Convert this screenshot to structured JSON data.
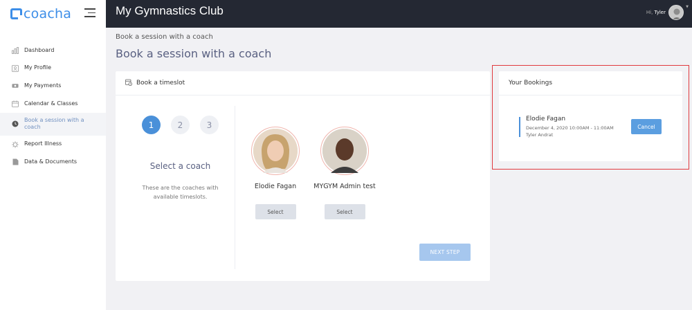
{
  "brand": {
    "name": "coacha",
    "color": "#3d8ee8"
  },
  "header": {
    "title": "My Gymnastics Club",
    "greeting_prefix": "Hi,",
    "user_name": "Tyler"
  },
  "sidebar": {
    "items": [
      {
        "label": "Dashboard",
        "icon": "chart-icon",
        "active": false
      },
      {
        "label": "My Profile",
        "icon": "profile-card-icon",
        "active": false
      },
      {
        "label": "My Payments",
        "icon": "money-icon",
        "active": false
      },
      {
        "label": "Calendar & Classes",
        "icon": "calendar-icon",
        "active": false
      },
      {
        "label": "Book a session with a coach",
        "icon": "clock-icon",
        "active": true
      },
      {
        "label": "Report Illness",
        "icon": "virus-icon",
        "active": false
      },
      {
        "label": "Data & Documents",
        "icon": "document-icon",
        "active": false
      }
    ]
  },
  "page": {
    "breadcrumb": "Book a session with a coach",
    "title": "Book a session with a coach"
  },
  "timeslot_card": {
    "title": "Book a timeslot",
    "steps": [
      "1",
      "2",
      "3"
    ],
    "active_step": 1,
    "step_title": "Select a coach",
    "step_desc": "These are the coaches with available timeslots.",
    "coaches": [
      {
        "name": "Elodie Fagan",
        "select_label": "Select"
      },
      {
        "name": "MYGYM Admin test",
        "select_label": "Select"
      }
    ],
    "next_label": "NEXT STEP"
  },
  "bookings_card": {
    "title": "Your Bookings",
    "items": [
      {
        "coach": "Elodie Fagan",
        "time": "December 4, 2020 10:00AM - 11:00AM",
        "person": "Tyler Andrat",
        "cancel_label": "Cancel"
      }
    ]
  },
  "colors": {
    "accent": "#4a90d9",
    "topbar": "#242833",
    "highlight": "#e0393e"
  }
}
